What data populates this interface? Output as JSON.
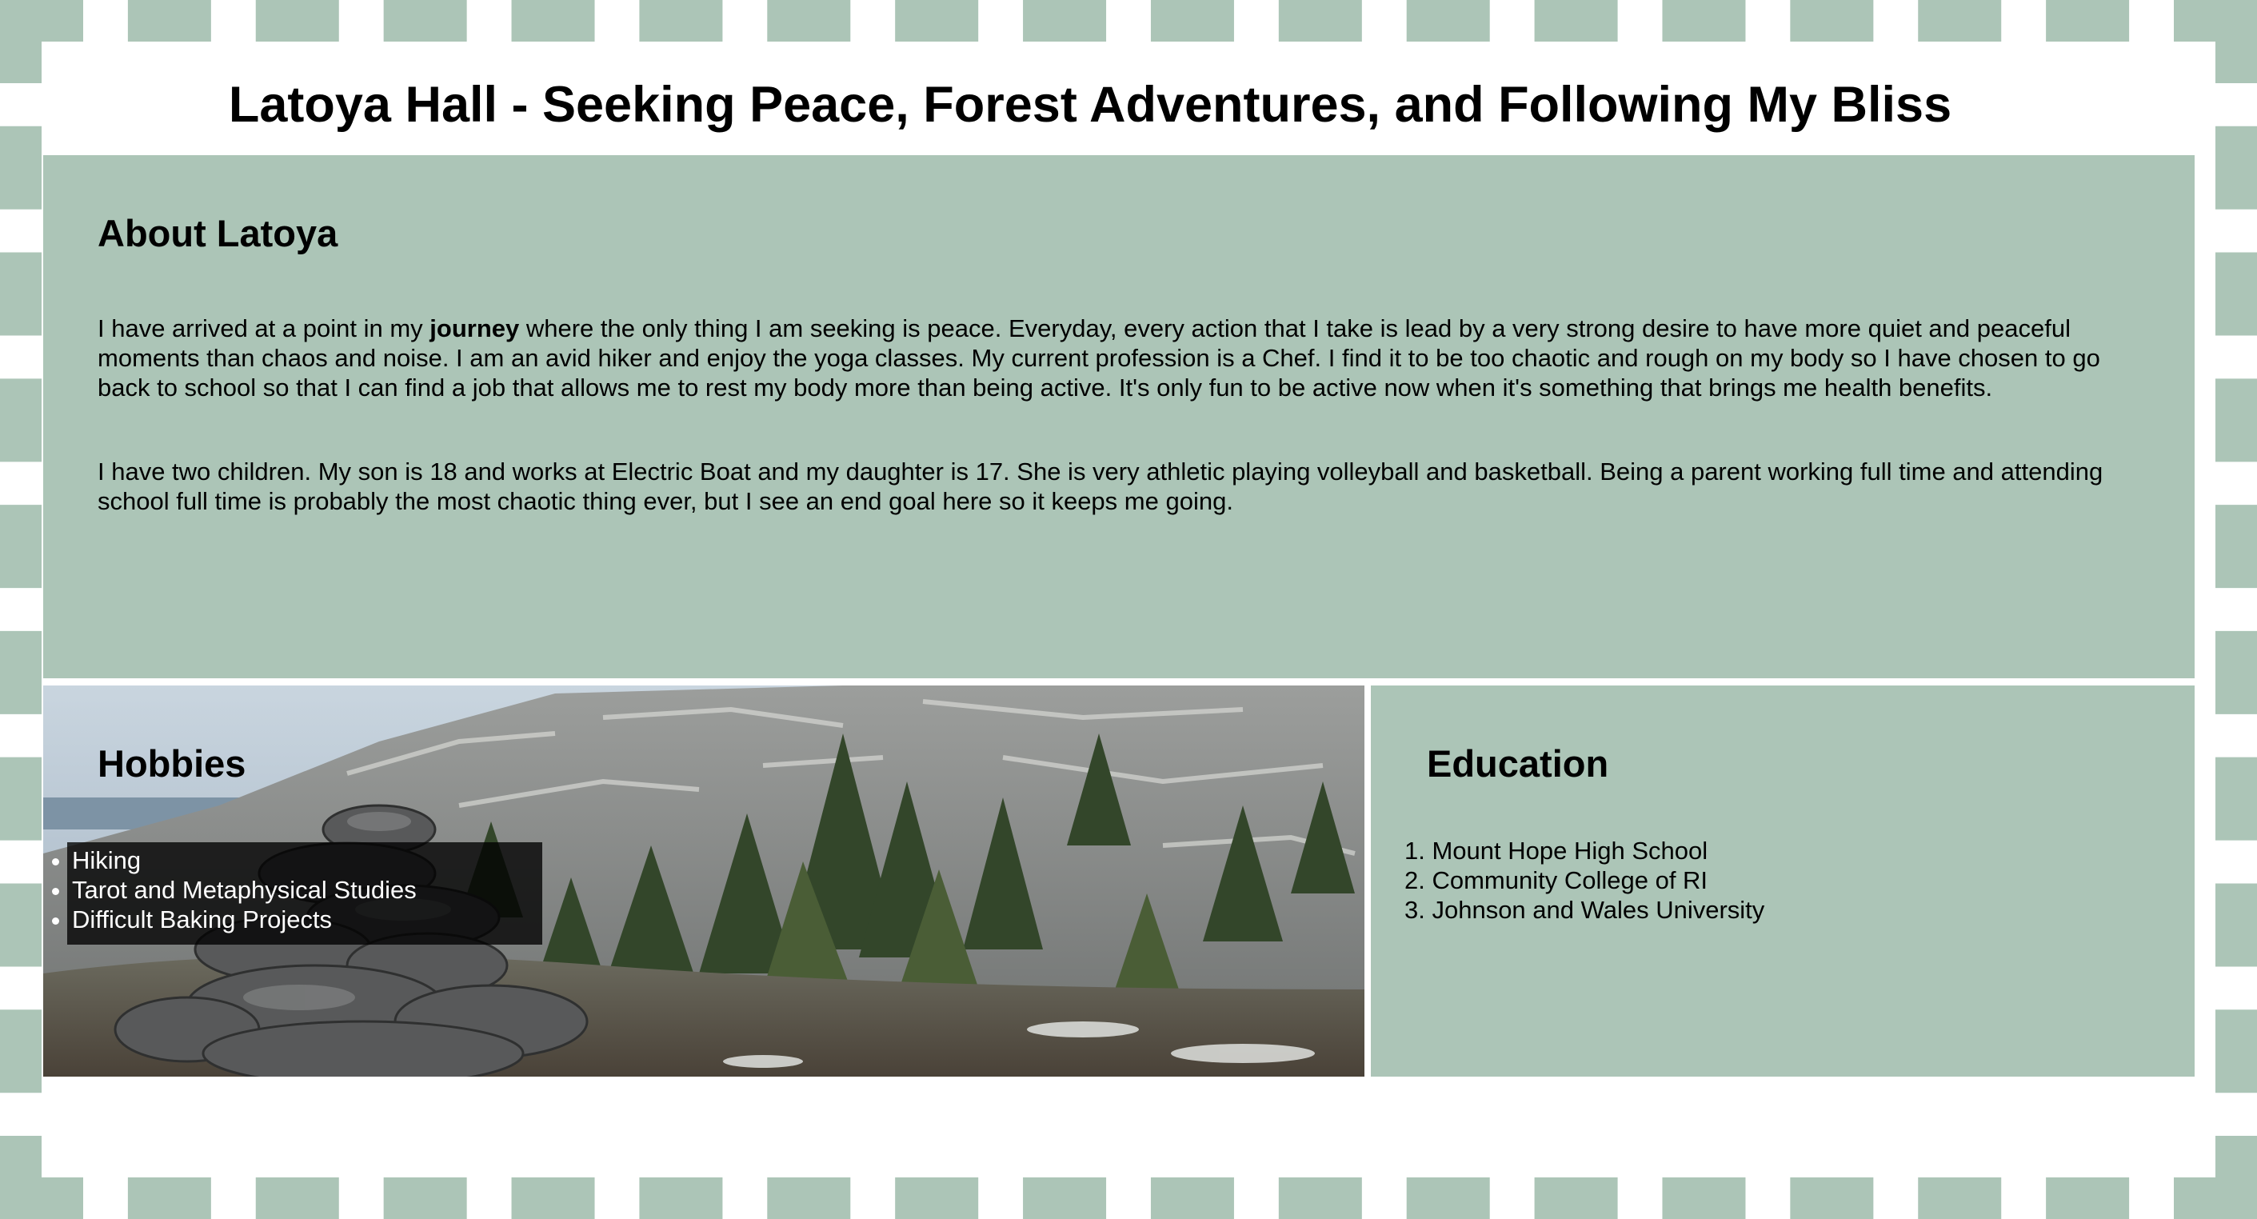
{
  "header": {
    "title": "Latoya Hall - Seeking Peace, Forest Adventures, and Following My Bliss"
  },
  "about": {
    "heading": "About Latoya",
    "p1_before": "I have arrived at a point in my ",
    "p1_bold": "journey",
    "p1_after": " where the only thing I am seeking is peace. Everyday, every action that I take is lead by a very strong desire to have more quiet and peaceful moments than chaos and noise. I am an avid hiker and enjoy the yoga classes. My current profession is a Chef. I find it to be too chaotic and rough on my body so I have chosen to go back to school so that I can find a job that allows me to rest my body more than being active. It's only fun to be active now when it's something that brings me health benefits.",
    "p2": "I have two children. My son is 18 and works at Electric Boat and my daughter is 17. She is very athletic playing volleyball and basketball. Being a parent working full time and attending school full time is probably the most chaotic thing ever, but I see an end goal here so it keeps me going."
  },
  "hobbies": {
    "heading": "Hobbies",
    "items": [
      "Hiking",
      "Tarot and Metaphysical Studies",
      "Difficult Baking Projects"
    ]
  },
  "education": {
    "heading": "Education",
    "items": [
      "Mount Hope High School",
      "Community College of RI",
      "Johnson and Wales University"
    ]
  },
  "colors": {
    "sage": "#acc5b7",
    "background": "#ffffff"
  }
}
